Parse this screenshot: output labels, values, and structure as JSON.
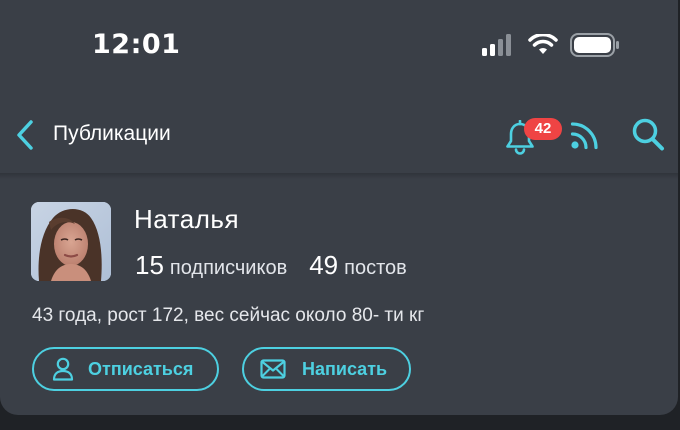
{
  "status_bar": {
    "time": "12:01"
  },
  "header": {
    "title": "Публикации",
    "notification_count": "42",
    "accent_color": "#4dd0e1"
  },
  "profile": {
    "name": "Наталья",
    "followers_count": "15",
    "followers_label": "подписчиков",
    "posts_count": "49",
    "posts_label": "постов",
    "bio": "43 года, рост 172, вес сейчас около 80- ти кг"
  },
  "actions": {
    "unsubscribe_label": "Отписаться",
    "write_label": "Написать"
  },
  "icons": [
    "back-chevron-icon",
    "bell-icon",
    "rss-icon",
    "search-icon",
    "user-icon",
    "envelope-icon",
    "signal-icon",
    "wifi-icon",
    "battery-icon"
  ]
}
